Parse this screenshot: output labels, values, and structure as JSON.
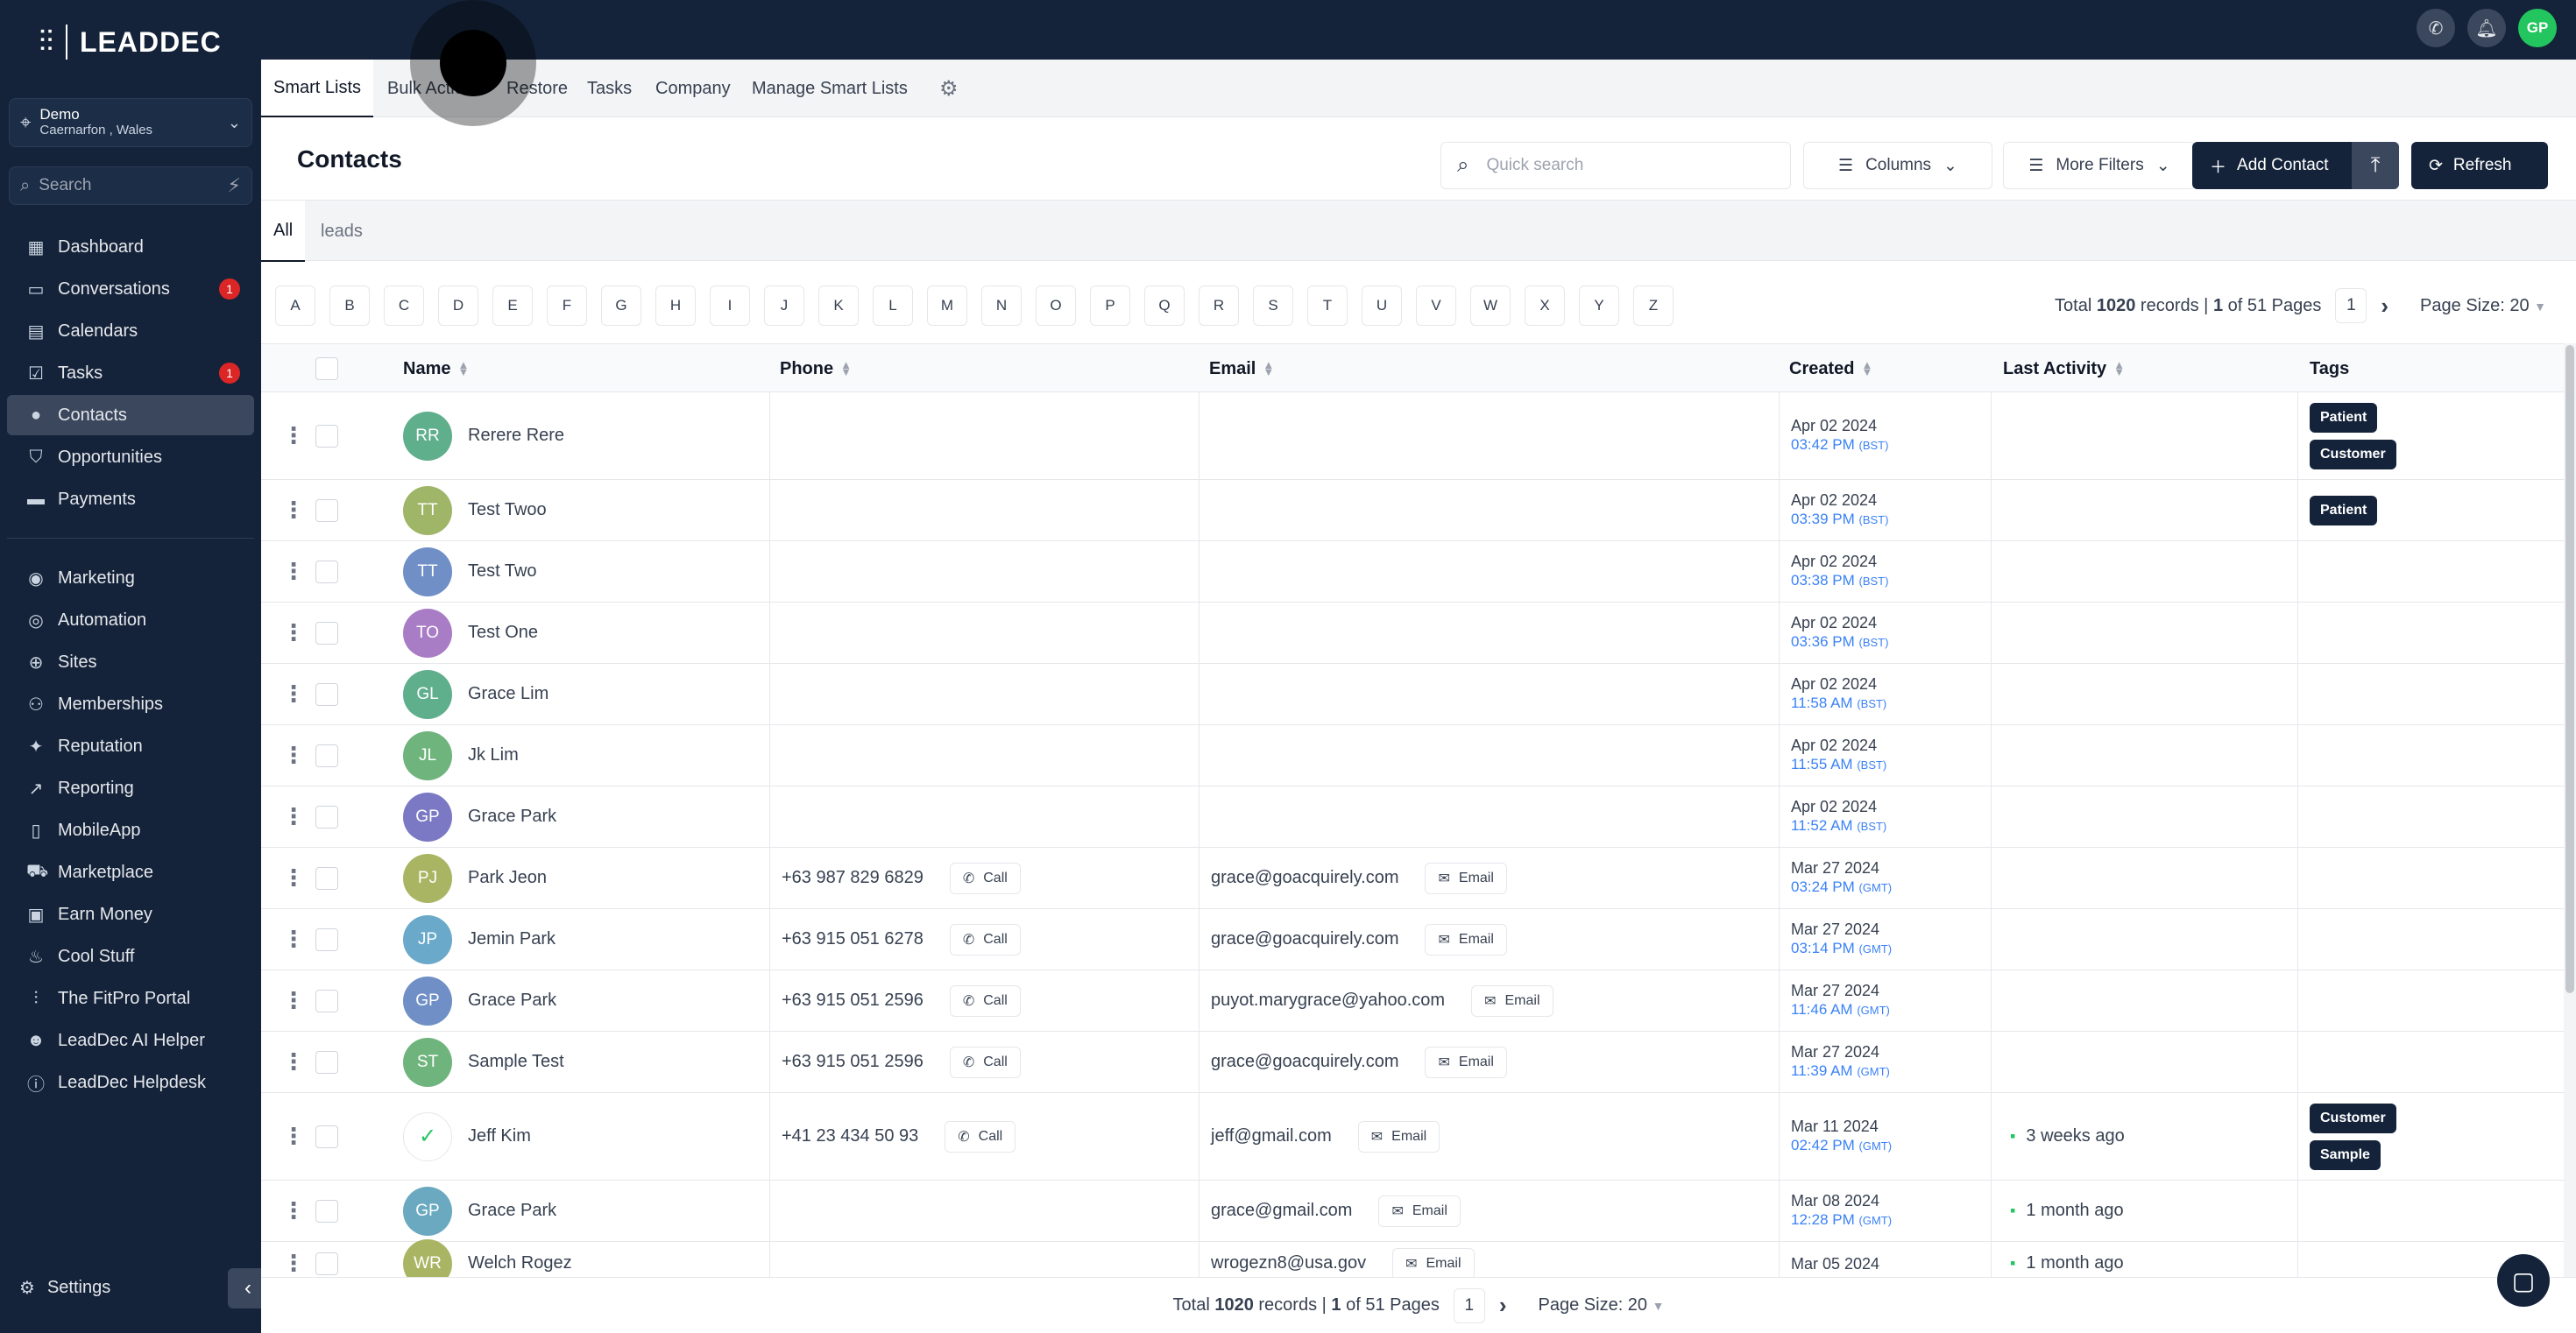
{
  "brand": {
    "logo_text": "LEADDEC"
  },
  "location": {
    "name": "Demo",
    "sub": "Caernarfon , Wales"
  },
  "sidebar_search": {
    "placeholder": "Search"
  },
  "nav": [
    {
      "label": "Dashboard",
      "icon": "dashboard-icon",
      "glyph": "▦"
    },
    {
      "label": "Conversations",
      "icon": "conversations-icon",
      "glyph": "▭",
      "badge": "1"
    },
    {
      "label": "Calendars",
      "icon": "calendar-icon",
      "glyph": "▤"
    },
    {
      "label": "Tasks",
      "icon": "tasks-icon",
      "glyph": "☑",
      "badge": "1"
    },
    {
      "label": "Contacts",
      "icon": "contacts-icon",
      "glyph": "●",
      "active": true
    },
    {
      "label": "Opportunities",
      "icon": "opportunities-icon",
      "glyph": "⛉"
    },
    {
      "label": "Payments",
      "icon": "payments-icon",
      "glyph": "▬"
    },
    {
      "label": "Marketing",
      "icon": "marketing-icon",
      "glyph": "◉"
    },
    {
      "label": "Automation",
      "icon": "automation-icon",
      "glyph": "◎"
    },
    {
      "label": "Sites",
      "icon": "sites-icon",
      "glyph": "⊕"
    },
    {
      "label": "Memberships",
      "icon": "memberships-icon",
      "glyph": "⚇"
    },
    {
      "label": "Reputation",
      "icon": "reputation-icon",
      "glyph": "✦"
    },
    {
      "label": "Reporting",
      "icon": "reporting-icon",
      "glyph": "↗"
    },
    {
      "label": "MobileApp",
      "icon": "mobile-icon",
      "glyph": "▯"
    },
    {
      "label": "Marketplace",
      "icon": "cart-icon",
      "glyph": "⛟"
    },
    {
      "label": "Earn Money",
      "icon": "money-icon",
      "glyph": "▣"
    },
    {
      "label": "Cool Stuff",
      "icon": "flame-icon",
      "glyph": "♨"
    },
    {
      "label": "The FitPro Portal",
      "icon": "dumbbell-icon",
      "glyph": "⫶"
    },
    {
      "label": "LeadDec AI Helper",
      "icon": "robot-icon",
      "glyph": "☻"
    },
    {
      "label": "LeadDec Helpdesk",
      "icon": "info-icon",
      "glyph": "ⓘ"
    }
  ],
  "settings_label": "Settings",
  "top_avatar": "GP",
  "tabs": [
    "Smart Lists",
    "Bulk Actions",
    "Restore",
    "Tasks",
    "Company",
    "Manage Smart Lists"
  ],
  "page_title": "Contacts",
  "quick_search": {
    "placeholder": "Quick search"
  },
  "buttons": {
    "columns": "Columns",
    "more_filters": "More Filters",
    "add_contact": "Add Contact",
    "refresh": "Refresh"
  },
  "subtabs": [
    "All",
    "leads"
  ],
  "letters": [
    "A",
    "B",
    "C",
    "D",
    "E",
    "F",
    "G",
    "H",
    "I",
    "J",
    "K",
    "L",
    "M",
    "N",
    "O",
    "P",
    "Q",
    "R",
    "S",
    "T",
    "U",
    "V",
    "W",
    "X",
    "Y",
    "Z"
  ],
  "pager": {
    "total_label": "Total",
    "total": "1020",
    "records": "records |",
    "page": "1",
    "of_pages": "of 51 Pages",
    "current": "1",
    "page_size": "Page Size: 20"
  },
  "columns": {
    "name": "Name",
    "phone": "Phone",
    "email": "Email",
    "created": "Created",
    "last_activity": "Last Activity",
    "tags": "Tags"
  },
  "call_label": "Call",
  "email_label": "Email",
  "rows": [
    {
      "initials": "RR",
      "name": "Rerere Rere",
      "color": "#5fae8c",
      "phone": "",
      "email": "",
      "date": "Apr 02 2024",
      "time": "03:42 PM",
      "tz": "(BST)",
      "activity": "",
      "tags": [
        "Patient",
        "Customer"
      ]
    },
    {
      "initials": "TT",
      "name": "Test Twoo",
      "color": "#9fb567",
      "phone": "",
      "email": "",
      "date": "Apr 02 2024",
      "time": "03:39 PM",
      "tz": "(BST)",
      "activity": "",
      "tags": [
        "Patient"
      ]
    },
    {
      "initials": "TT",
      "name": "Test Two",
      "color": "#6f8fc6",
      "phone": "",
      "email": "",
      "date": "Apr 02 2024",
      "time": "03:38 PM",
      "tz": "(BST)",
      "activity": "",
      "tags": []
    },
    {
      "initials": "TO",
      "name": "Test One",
      "color": "#a97cc6",
      "phone": "",
      "email": "",
      "date": "Apr 02 2024",
      "time": "03:36 PM",
      "tz": "(BST)",
      "activity": "",
      "tags": []
    },
    {
      "initials": "GL",
      "name": "Grace Lim",
      "color": "#5fae8c",
      "phone": "",
      "email": "",
      "date": "Apr 02 2024",
      "time": "11:58 AM",
      "tz": "(BST)",
      "activity": "",
      "tags": []
    },
    {
      "initials": "JL",
      "name": "Jk Lim",
      "color": "#6fb47d",
      "phone": "",
      "email": "",
      "date": "Apr 02 2024",
      "time": "11:55 AM",
      "tz": "(BST)",
      "activity": "",
      "tags": []
    },
    {
      "initials": "GP",
      "name": "Grace Park",
      "color": "#7b78c4",
      "phone": "",
      "email": "",
      "date": "Apr 02 2024",
      "time": "11:52 AM",
      "tz": "(BST)",
      "activity": "",
      "tags": []
    },
    {
      "initials": "PJ",
      "name": "Park Jeon",
      "color": "#a9b563",
      "phone": "+63 987 829 6829",
      "email": "grace@goacquirely.com",
      "date": "Mar 27 2024",
      "time": "03:24 PM",
      "tz": "(GMT)",
      "activity": "",
      "tags": []
    },
    {
      "initials": "JP",
      "name": "Jemin Park",
      "color": "#6aa9c9",
      "phone": "+63 915 051 6278",
      "email": "grace@goacquirely.com",
      "date": "Mar 27 2024",
      "time": "03:14 PM",
      "tz": "(GMT)",
      "activity": "",
      "tags": []
    },
    {
      "initials": "GP",
      "name": "Grace Park",
      "color": "#6f8fc6",
      "phone": "+63 915 051 2596",
      "email": "puyot.marygrace@yahoo.com",
      "date": "Mar 27 2024",
      "time": "11:46 AM",
      "tz": "(GMT)",
      "activity": "",
      "tags": []
    },
    {
      "initials": "ST",
      "name": "Sample Test",
      "color": "#6fb47d",
      "phone": "+63 915 051 2596",
      "email": "grace@goacquirely.com",
      "date": "Mar 27 2024",
      "time": "11:39 AM",
      "tz": "(GMT)",
      "activity": "",
      "tags": []
    },
    {
      "initials": "",
      "name": "Jeff Kim",
      "color": "#ffffff",
      "phone": "+41 23 434 50 93",
      "email": "jeff@gmail.com",
      "date": "Mar 11 2024",
      "time": "02:42 PM",
      "tz": "(GMT)",
      "activity": "3 weeks ago",
      "tags": [
        "Customer",
        "Sample"
      ]
    },
    {
      "initials": "GP",
      "name": "Grace Park",
      "color": "#6aa9c0",
      "phone": "",
      "email": "grace@gmail.com",
      "date": "Mar 08 2024",
      "time": "12:28 PM",
      "tz": "(GMT)",
      "activity": "1 month ago",
      "tags": []
    },
    {
      "initials": "WR",
      "name": "Welch Rogez",
      "color": "#a9b563",
      "phone": "",
      "email": "wrogezn8@usa.gov",
      "date": "Mar 05 2024",
      "time": "",
      "tz": "",
      "activity": "1 month ago",
      "tags": []
    }
  ]
}
